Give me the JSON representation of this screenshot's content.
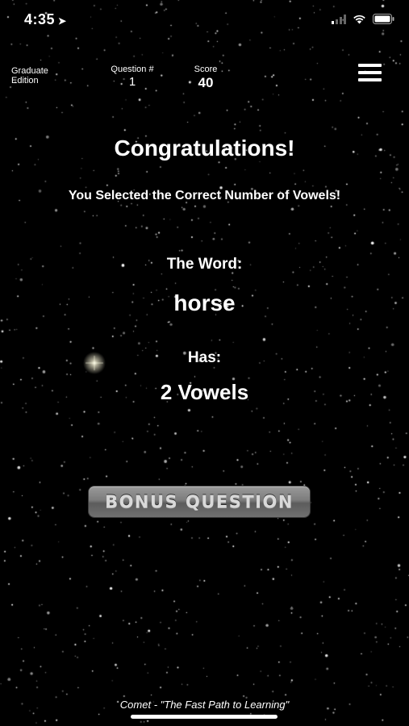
{
  "status_bar": {
    "time": "4:35",
    "icons": [
      "location-arrow-icon",
      "signal-icon",
      "wifi-icon",
      "battery-icon"
    ]
  },
  "header": {
    "edition": "Graduate Edition",
    "question_label": "Question #",
    "question_value": "1",
    "score_label": "Score",
    "score_value": "40",
    "menu_icon": "hamburger-menu-icon"
  },
  "result": {
    "title": "Congratulations!",
    "message": "You Selected the Correct Number of Vowels!",
    "word_label": "The Word:",
    "word": "horse",
    "has_label": "Has:",
    "vowel_count": "2 Vowels"
  },
  "bonus_button": {
    "label": "BONUS QUESTION"
  },
  "footer": {
    "tagline": "Comet - \"The Fast Path to Learning\""
  },
  "colors": {
    "background": "#000000",
    "text": "#ffffff",
    "button_gray": "#7c7c7c"
  }
}
